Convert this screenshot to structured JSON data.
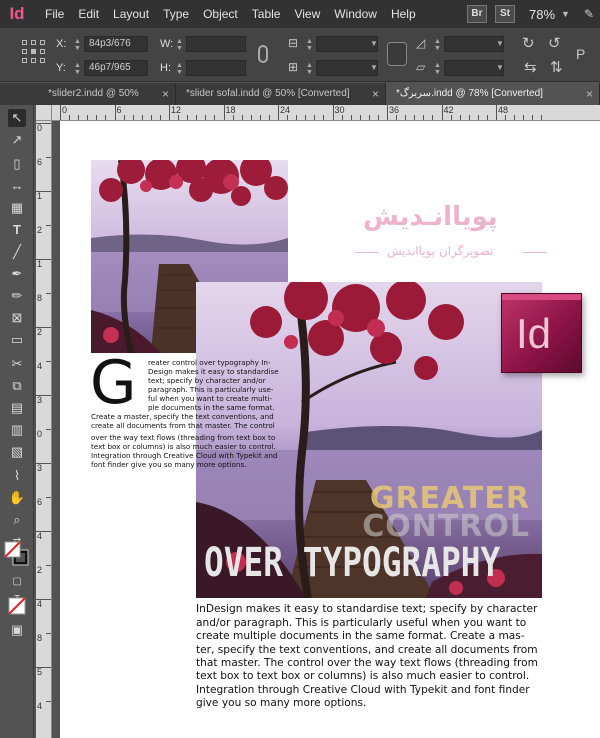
{
  "app": {
    "logo": "Id",
    "menu": [
      "File",
      "Edit",
      "Layout",
      "Type",
      "Object",
      "Table",
      "View",
      "Window",
      "Help"
    ],
    "bridge_badge": "Br",
    "stock_badge": "St",
    "zoom": "78%"
  },
  "control": {
    "x_label": "X:",
    "x_value": "84p3/676",
    "y_label": "Y:",
    "y_value": "46p7/965",
    "w_label": "W:",
    "h_label": "H:"
  },
  "tabs": [
    {
      "label": "*slider2.indd @ 50%",
      "active": false
    },
    {
      "label": "*slider sofal.indd @ 50% [Converted]",
      "active": false
    },
    {
      "label": "*سربرگ.indd @ 78% [Converted]",
      "active": true
    }
  ],
  "ruler": {
    "top_labels": [
      "0",
      "6",
      "12",
      "18",
      "24",
      "30",
      "36",
      "42",
      "48"
    ],
    "left_labels": [
      "0",
      "6",
      "1",
      "2",
      "1",
      "8",
      "2",
      "4",
      "3",
      "0",
      "3",
      "6",
      "4",
      "2",
      "4",
      "8",
      "5",
      "4"
    ]
  },
  "document": {
    "dropcap": "G",
    "small_para_lines": [
      "reater control over typography  In-",
      "Design makes it easy to standardise",
      "text; specify by character and/or",
      "paragraph. This is particularly use-",
      "ful when you want to create multi-",
      "ple documents in the same format.",
      "Create a master, specify the text conventions, and",
      "create all documents from that master. The control",
      "over the way text flows (threading from text box to",
      "text box or columns) is also much easier to control.",
      "Integration through Creative Cloud with Typekit and",
      "font finder give you so many more options."
    ],
    "overlay_line1": "GREATER",
    "overlay_line2": "CONTROL",
    "overlay_line3": "OVER TYPOGRAPHY",
    "body_lines": [
      "InDesign makes it easy to standardise text; specify by character",
      "and/or paragraph. This is particularly useful when you want to",
      "create multiple documents in the same format. Create a mas-",
      "ter, specify the text conventions, and create all documents from",
      "that master. The control over the way text flows (threading from",
      "text box to text box or columns) is also much easier to control.",
      "Integration through Creative Cloud with Typekit and font finder",
      "give you so many more options."
    ],
    "id_logo": "Id",
    "watermark_main": "پویاانـدیش",
    "watermark_sub": "تصویرگران پویااندیش"
  },
  "icons": {
    "selection": "selection-tool-icon",
    "direct_selection": "direct-selection-icon",
    "page_tool": "page-tool-icon",
    "gap_tool": "gap-tool-icon",
    "content_collector": "content-collector-icon",
    "type_tool": "type-tool-icon",
    "line_tool": "line-tool-icon",
    "pen_tool": "pen-tool-icon",
    "pencil_tool": "pencil-tool-icon",
    "rect_frame": "rectangle-frame-icon",
    "rectangle": "rectangle-tool-icon",
    "scissors": "scissors-icon",
    "free_transform": "free-transform-icon",
    "gradient": "gradient-swatch-icon",
    "gradient_feather": "gradient-feather-icon",
    "note": "note-tool-icon",
    "eyedropper": "eyedropper-icon",
    "hand": "hand-icon",
    "zoom": "zoom-icon"
  }
}
